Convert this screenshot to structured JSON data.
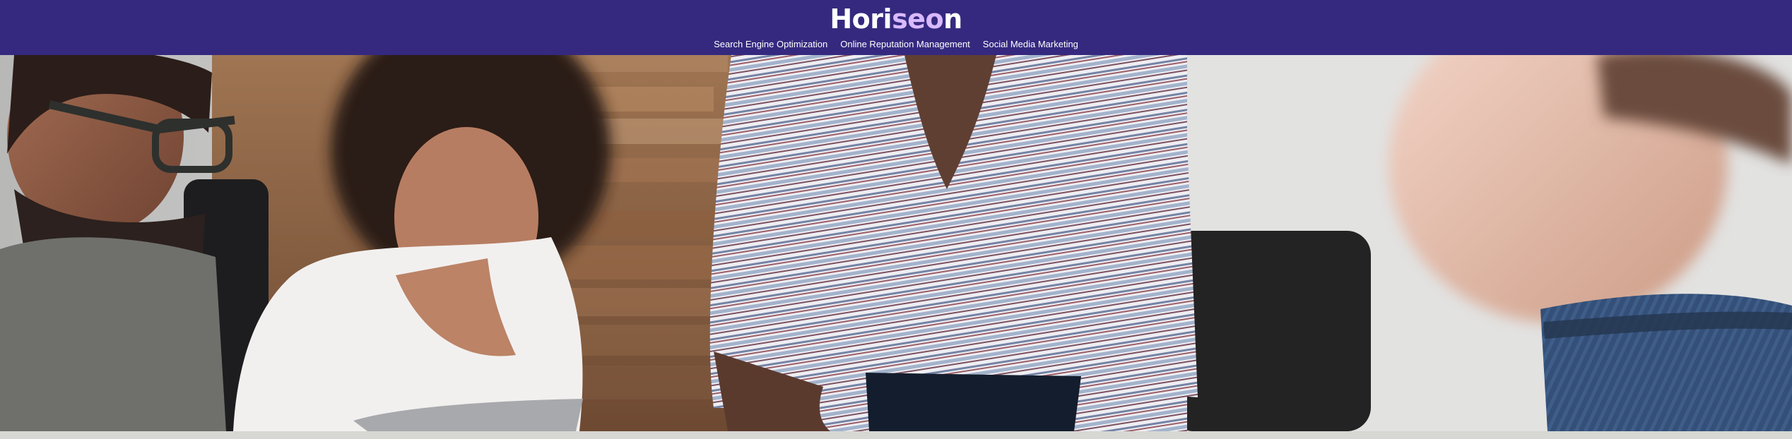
{
  "header": {
    "brand": {
      "left": "Hori",
      "accent": "seo",
      "right": "n"
    },
    "nav": [
      "Search Engine Optimization",
      "Online Reputation Management",
      "Social Media Marketing"
    ]
  },
  "hero": {
    "image": "team-meeting-photo"
  },
  "colors": {
    "header_background": "#35297f",
    "brand_accent": "#d9b9ff",
    "hero_wood": "#9b704d",
    "shirt_stripe_blue": "#6f83a8"
  }
}
